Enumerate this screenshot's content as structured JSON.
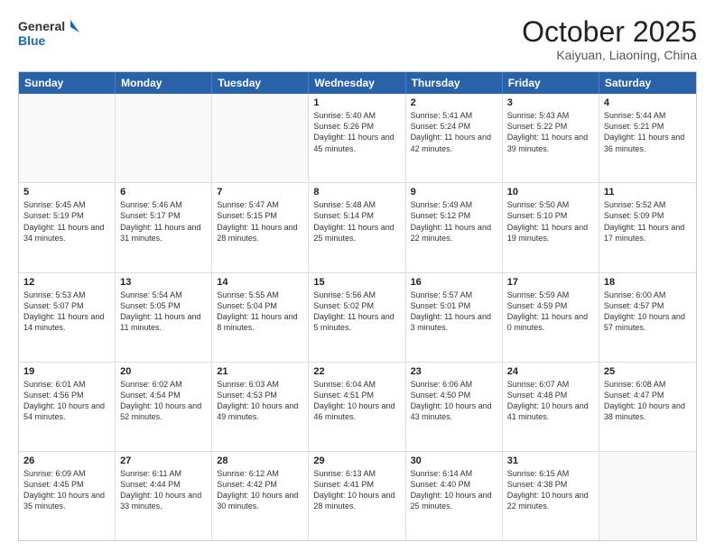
{
  "header": {
    "logo_general": "General",
    "logo_blue": "Blue",
    "month": "October 2025",
    "location": "Kaiyuan, Liaoning, China"
  },
  "days_of_week": [
    "Sunday",
    "Monday",
    "Tuesday",
    "Wednesday",
    "Thursday",
    "Friday",
    "Saturday"
  ],
  "weeks": [
    [
      {
        "day": "",
        "text": "",
        "empty": true
      },
      {
        "day": "",
        "text": "",
        "empty": true
      },
      {
        "day": "",
        "text": "",
        "empty": true
      },
      {
        "day": "1",
        "text": "Sunrise: 5:40 AM\nSunset: 5:26 PM\nDaylight: 11 hours and 45 minutes."
      },
      {
        "day": "2",
        "text": "Sunrise: 5:41 AM\nSunset: 5:24 PM\nDaylight: 11 hours and 42 minutes."
      },
      {
        "day": "3",
        "text": "Sunrise: 5:43 AM\nSunset: 5:22 PM\nDaylight: 11 hours and 39 minutes."
      },
      {
        "day": "4",
        "text": "Sunrise: 5:44 AM\nSunset: 5:21 PM\nDaylight: 11 hours and 36 minutes."
      }
    ],
    [
      {
        "day": "5",
        "text": "Sunrise: 5:45 AM\nSunset: 5:19 PM\nDaylight: 11 hours and 34 minutes."
      },
      {
        "day": "6",
        "text": "Sunrise: 5:46 AM\nSunset: 5:17 PM\nDaylight: 11 hours and 31 minutes."
      },
      {
        "day": "7",
        "text": "Sunrise: 5:47 AM\nSunset: 5:15 PM\nDaylight: 11 hours and 28 minutes."
      },
      {
        "day": "8",
        "text": "Sunrise: 5:48 AM\nSunset: 5:14 PM\nDaylight: 11 hours and 25 minutes."
      },
      {
        "day": "9",
        "text": "Sunrise: 5:49 AM\nSunset: 5:12 PM\nDaylight: 11 hours and 22 minutes."
      },
      {
        "day": "10",
        "text": "Sunrise: 5:50 AM\nSunset: 5:10 PM\nDaylight: 11 hours and 19 minutes."
      },
      {
        "day": "11",
        "text": "Sunrise: 5:52 AM\nSunset: 5:09 PM\nDaylight: 11 hours and 17 minutes."
      }
    ],
    [
      {
        "day": "12",
        "text": "Sunrise: 5:53 AM\nSunset: 5:07 PM\nDaylight: 11 hours and 14 minutes."
      },
      {
        "day": "13",
        "text": "Sunrise: 5:54 AM\nSunset: 5:05 PM\nDaylight: 11 hours and 11 minutes."
      },
      {
        "day": "14",
        "text": "Sunrise: 5:55 AM\nSunset: 5:04 PM\nDaylight: 11 hours and 8 minutes."
      },
      {
        "day": "15",
        "text": "Sunrise: 5:56 AM\nSunset: 5:02 PM\nDaylight: 11 hours and 5 minutes."
      },
      {
        "day": "16",
        "text": "Sunrise: 5:57 AM\nSunset: 5:01 PM\nDaylight: 11 hours and 3 minutes."
      },
      {
        "day": "17",
        "text": "Sunrise: 5:59 AM\nSunset: 4:59 PM\nDaylight: 11 hours and 0 minutes."
      },
      {
        "day": "18",
        "text": "Sunrise: 6:00 AM\nSunset: 4:57 PM\nDaylight: 10 hours and 57 minutes."
      }
    ],
    [
      {
        "day": "19",
        "text": "Sunrise: 6:01 AM\nSunset: 4:56 PM\nDaylight: 10 hours and 54 minutes."
      },
      {
        "day": "20",
        "text": "Sunrise: 6:02 AM\nSunset: 4:54 PM\nDaylight: 10 hours and 52 minutes."
      },
      {
        "day": "21",
        "text": "Sunrise: 6:03 AM\nSunset: 4:53 PM\nDaylight: 10 hours and 49 minutes."
      },
      {
        "day": "22",
        "text": "Sunrise: 6:04 AM\nSunset: 4:51 PM\nDaylight: 10 hours and 46 minutes."
      },
      {
        "day": "23",
        "text": "Sunrise: 6:06 AM\nSunset: 4:50 PM\nDaylight: 10 hours and 43 minutes."
      },
      {
        "day": "24",
        "text": "Sunrise: 6:07 AM\nSunset: 4:48 PM\nDaylight: 10 hours and 41 minutes."
      },
      {
        "day": "25",
        "text": "Sunrise: 6:08 AM\nSunset: 4:47 PM\nDaylight: 10 hours and 38 minutes."
      }
    ],
    [
      {
        "day": "26",
        "text": "Sunrise: 6:09 AM\nSunset: 4:45 PM\nDaylight: 10 hours and 35 minutes."
      },
      {
        "day": "27",
        "text": "Sunrise: 6:11 AM\nSunset: 4:44 PM\nDaylight: 10 hours and 33 minutes."
      },
      {
        "day": "28",
        "text": "Sunrise: 6:12 AM\nSunset: 4:42 PM\nDaylight: 10 hours and 30 minutes."
      },
      {
        "day": "29",
        "text": "Sunrise: 6:13 AM\nSunset: 4:41 PM\nDaylight: 10 hours and 28 minutes."
      },
      {
        "day": "30",
        "text": "Sunrise: 6:14 AM\nSunset: 4:40 PM\nDaylight: 10 hours and 25 minutes."
      },
      {
        "day": "31",
        "text": "Sunrise: 6:15 AM\nSunset: 4:38 PM\nDaylight: 10 hours and 22 minutes."
      },
      {
        "day": "",
        "text": "",
        "empty": true
      }
    ]
  ]
}
